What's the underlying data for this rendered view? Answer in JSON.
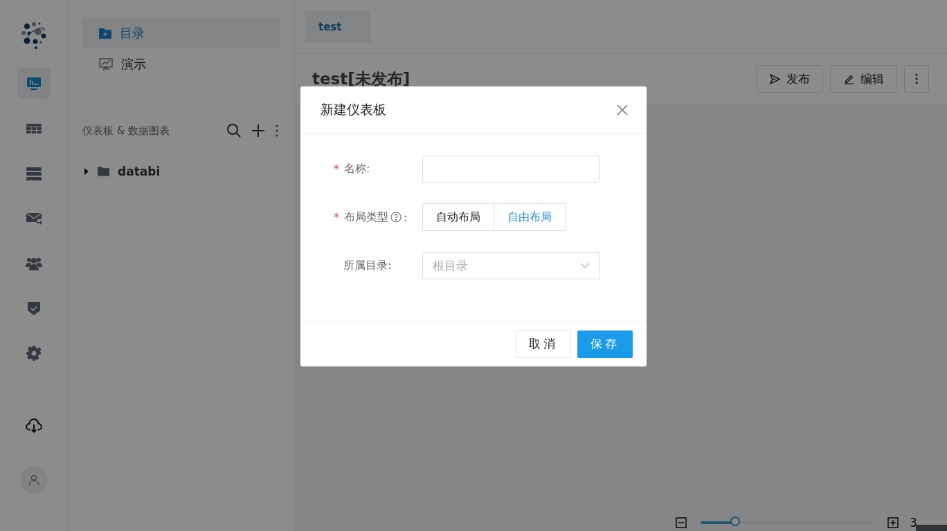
{
  "rail": {
    "items": [
      {
        "kind": "dashboard",
        "selected": true
      },
      {
        "kind": "table",
        "selected": false
      },
      {
        "kind": "database",
        "selected": false
      },
      {
        "kind": "mail",
        "selected": false
      },
      {
        "kind": "users",
        "selected": false
      },
      {
        "kind": "shield",
        "selected": false
      },
      {
        "kind": "gear",
        "selected": false
      }
    ]
  },
  "nav": {
    "items": [
      {
        "label": "目录",
        "kind": "folder",
        "selected": true
      },
      {
        "label": "演示",
        "kind": "present",
        "selected": false
      }
    ]
  },
  "section": {
    "title": "仪表板 & 数据图表"
  },
  "tree": [
    {
      "label": "databi",
      "expanded": false
    }
  ],
  "tabs": [
    {
      "label": "test",
      "selected": true
    }
  ],
  "page": {
    "title": "test[未发布]",
    "buttons": [
      {
        "label": "发布",
        "kind": "send"
      },
      {
        "label": "编辑",
        "kind": "edit"
      }
    ]
  },
  "zoom": {
    "level": 0.2,
    "reading": "3"
  },
  "dialog": {
    "title": "新建仪表板",
    "fields": [
      {
        "kind": "input",
        "label": "名称:",
        "required_mark": "*"
      },
      {
        "kind": "segmented",
        "label": "布局类型",
        "help": true,
        "colon": ":",
        "required_mark": "*",
        "options": [
          {
            "label": "自动布局",
            "selected": false
          },
          {
            "label": "自由布局",
            "selected": true
          }
        ]
      },
      {
        "kind": "select",
        "label": "所属目录:",
        "placeholder": "根目录"
      }
    ],
    "cancel": "取消",
    "save": "保存"
  }
}
